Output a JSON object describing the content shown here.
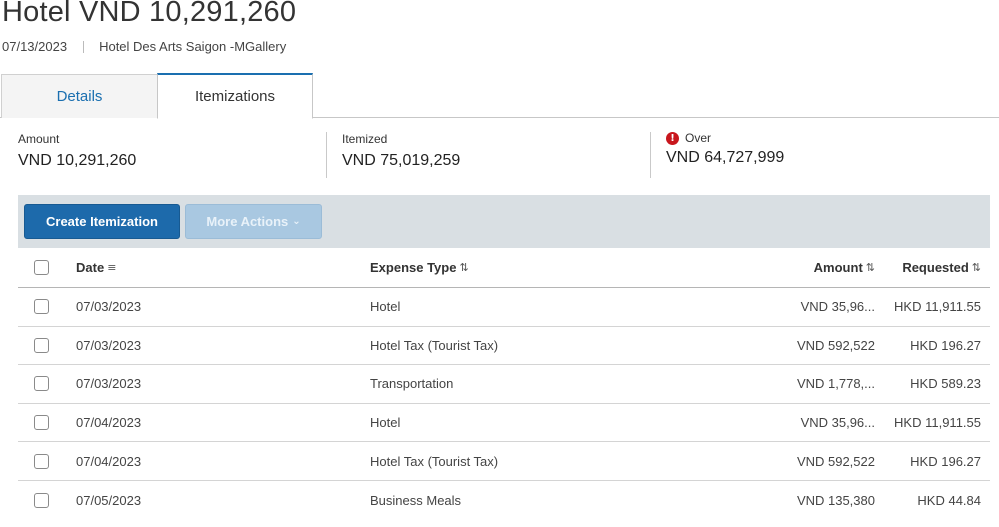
{
  "header": {
    "title": "Hotel VND 10,291,260",
    "date": "07/13/2023",
    "vendor": "Hotel Des Arts Saigon -MGallery"
  },
  "tabs": [
    {
      "label": "Details",
      "active": false
    },
    {
      "label": "Itemizations",
      "active": true
    }
  ],
  "summary": {
    "amount_label": "Amount",
    "amount_value": "VND 10,291,260",
    "itemized_label": "Itemized",
    "itemized_value": "VND 75,019,259",
    "over_label": "Over",
    "over_value": "VND 64,727,999",
    "over_icon": "warning-icon"
  },
  "toolbar": {
    "create_label": "Create Itemization",
    "more_label": "More Actions"
  },
  "table": {
    "columns": {
      "date": "Date",
      "expense_type": "Expense Type",
      "amount": "Amount",
      "requested": "Requested"
    },
    "rows": [
      {
        "date": "07/03/2023",
        "expense_type": "Hotel",
        "amount": "VND 35,96...",
        "requested": "HKD 11,911.55"
      },
      {
        "date": "07/03/2023",
        "expense_type": "Hotel Tax (Tourist Tax)",
        "amount": "VND 592,522",
        "requested": "HKD 196.27"
      },
      {
        "date": "07/03/2023",
        "expense_type": "Transportation",
        "amount": "VND 1,778,...",
        "requested": "HKD 589.23"
      },
      {
        "date": "07/04/2023",
        "expense_type": "Hotel",
        "amount": "VND 35,96...",
        "requested": "HKD 11,911.55"
      },
      {
        "date": "07/04/2023",
        "expense_type": "Hotel Tax (Tourist Tax)",
        "amount": "VND 592,522",
        "requested": "HKD 196.27"
      },
      {
        "date": "07/05/2023",
        "expense_type": "Business Meals",
        "amount": "VND 135,380",
        "requested": "HKD 44.84"
      }
    ]
  },
  "colors": {
    "primary": "#1d6aab",
    "primary_disabled": "#a9c8e1",
    "tab_link": "#1a6fb0",
    "warning": "#c8161d",
    "toolbar_bg": "#d9dfe3"
  }
}
